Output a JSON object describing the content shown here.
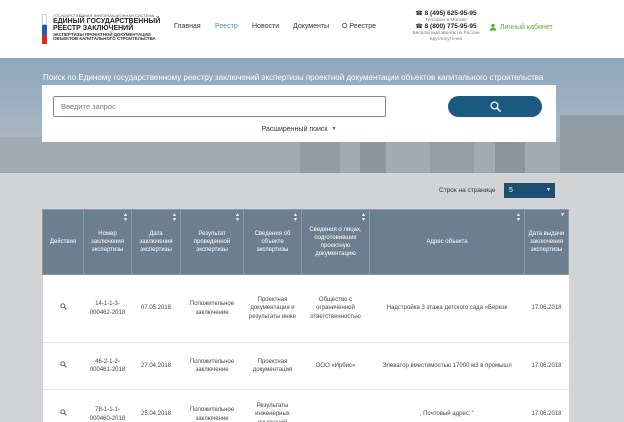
{
  "header": {
    "logo": {
      "line1": "ГОСУДАРСТВЕННАЯ ИНФОРМАЦИОННАЯ СИСТЕМА",
      "line2": "ЕДИНЫЙ ГОСУДАРСТВЕННЫЙ",
      "line3": "РЕЕСТР ЗАКЛЮЧЕНИЙ",
      "line4": "ЭКСПЕРТИЗЫ ПРОЕКТНОЙ ДОКУМЕНТАЦИИ",
      "line5": "ОБЪЕКТОВ КАПИТАЛЬНОГО СТРОИТЕЛЬСТВА",
      "flag_colors": [
        "#ffffff",
        "#1f5fb0",
        "#d52b1e"
      ]
    },
    "nav": [
      {
        "label": "Главная",
        "active": false
      },
      {
        "label": "Реестр",
        "active": true
      },
      {
        "label": "Новости",
        "active": false
      },
      {
        "label": "Документы",
        "active": false
      },
      {
        "label": "О Реестре",
        "active": false
      }
    ],
    "contacts": {
      "phone_moscow": "8 (495) 625-95-95",
      "phone_moscow_note": "Телефон в Москве",
      "phone_free": "8 (800) 775-95-95",
      "phone_free_note_1": "Бесплатный звонок по России",
      "phone_free_note_2": "Круглосуточно"
    },
    "cabinet_label": "Личный кабинет"
  },
  "search": {
    "title": "Поиск по Единому государственному реестру заключений экспертизы проектной документации объектов капитального строительства",
    "placeholder": "Введите запрос",
    "advanced_label": "Расширенный поиск"
  },
  "rows_per_page": {
    "label": "Строк на странице",
    "value": "5"
  },
  "colors": {
    "header_accent": "#4a90b8",
    "green": "#5bb135",
    "search_button": "#1b5a80",
    "table_header": "#6c7f91",
    "content_bg": "#d1d3d4"
  },
  "table": {
    "columns": [
      "Действия",
      "Номер заключения экспертизы",
      "Дата заключения экспертизы",
      "Результат проведенной экспертизы",
      "Сведения об объекте экспертизы",
      "Сведения о лицах, подготовивших проектную документацию",
      "Адрес объекта",
      "Дата выдачи заключения экспертизы"
    ],
    "rows": [
      {
        "number": "14-1-1-3-000462-2018",
        "date": "07.05.2018",
        "result": "Положительное заключение",
        "object": "Проектная документация и результаты инже",
        "preparer": "Общество с ограниченной ответственностью",
        "address": "Надстройка 3 этажа детского сада «Березк",
        "issue_date": "17.06.2018"
      },
      {
        "number": "46-2-1-2-000461-2018",
        "date": "27.04.2018",
        "result": "Положительное заключение",
        "object": "Проектная документация",
        "preparer": "ООО «Ирбис»",
        "address": "Элеватор вместимостью 17000 м3 в промышл",
        "issue_date": "17.06.2018"
      },
      {
        "number": "78-1-1-1-000460-2018",
        "date": "25.04.2018",
        "result": "Положительное заключение",
        "object": "Результаты инженерных изысканий",
        "preparer": "",
        "address": ", Почтовый адрес: \"",
        "issue_date": "17.06.2018"
      }
    ]
  }
}
